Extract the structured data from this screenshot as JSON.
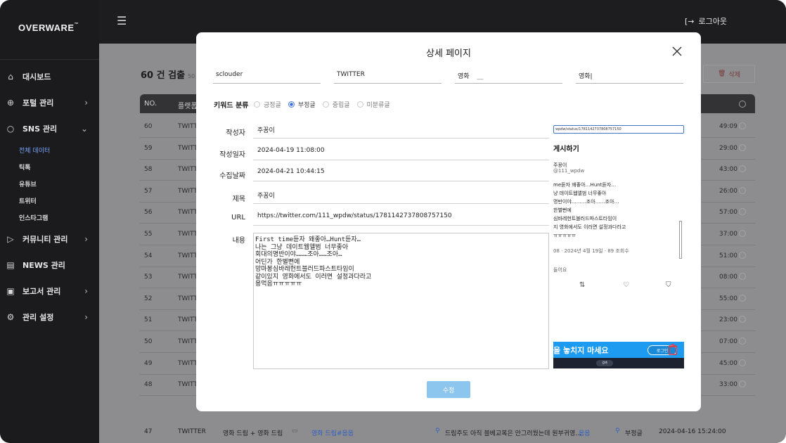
{
  "brand": {
    "logo": "OVERWARE",
    "logo_tm": "™"
  },
  "topbar": {
    "logout_label": "로그아웃"
  },
  "sidebar": {
    "items": [
      {
        "label": "대시보드"
      },
      {
        "label": "포털 관리"
      },
      {
        "label": "SNS 관리"
      },
      {
        "label": "커뮤니티 관리"
      },
      {
        "label": "NEWS 관리"
      },
      {
        "label": "보고서 관리"
      },
      {
        "label": "관리 설정"
      }
    ],
    "sns_sub": [
      "전체 데이터",
      "틱톡",
      "유튜브",
      "트위터",
      "인스타그램"
    ]
  },
  "list": {
    "count_label": "60 건 검출",
    "count_sub": "50",
    "delete_label": "삭제",
    "header": {
      "no": "NO.",
      "platform": "플랫폼"
    },
    "rows": [
      {
        "no": "60",
        "platform": "TWITT",
        "time": "49:09"
      },
      {
        "no": "59",
        "platform": "TWITT",
        "time": "29:00"
      },
      {
        "no": "58",
        "platform": "TWITT",
        "time": "43:00"
      },
      {
        "no": "57",
        "platform": "TWITT",
        "time": "26:00"
      },
      {
        "no": "56",
        "platform": "TWITT",
        "time": "57:00"
      },
      {
        "no": "55",
        "platform": "TWITT",
        "time": "37:00"
      },
      {
        "no": "54",
        "platform": "TWITT",
        "time": "51:00"
      },
      {
        "no": "53",
        "platform": "TWITT",
        "time": "08:00"
      },
      {
        "no": "52",
        "platform": "TWITT",
        "time": "55:00"
      },
      {
        "no": "51",
        "platform": "TWITT",
        "time": "23:00"
      },
      {
        "no": "50",
        "platform": "TWITT",
        "time": "07:00"
      },
      {
        "no": "49",
        "platform": "TWITT",
        "time": "45:00"
      },
      {
        "no": "48",
        "platform": "TWITT",
        "time": "33:00"
      }
    ],
    "last_row": {
      "no": "47",
      "platform": "TWITTER",
      "keyword": "영화 드림 + 영화 드림",
      "tag": "영화 드림#음음",
      "title": "드림주도 아직 블베교복은 안그러웠는데 원부귀영…",
      "tag2": "음음",
      "sentiment": "부정글",
      "datetime": "2024-04-16 15:24:00"
    }
  },
  "modal": {
    "title": "상세 페이지",
    "fields": {
      "user": "sclouder",
      "platform": "TWITTER",
      "kw1": "영화",
      "kw1_tail": "__",
      "kw2": "영화|"
    },
    "keyword_label": "키워드 분류",
    "radios": [
      "긍정글",
      "부정글",
      "중립글",
      "미분류글"
    ],
    "selected_radio": "부정글",
    "labels": {
      "author": "작성자",
      "written": "작성일자",
      "collected": "수집날짜",
      "title": "제목",
      "url": "URL",
      "content": "내용"
    },
    "values": {
      "author": "주꽁이",
      "written": "2024-04-19 11:08:00",
      "collected": "2024-04-21 10:44:15",
      "title": "주꽁이",
      "url": "https://twitter.com/111_wpdw/status/1781142737808757150"
    },
    "content": "First time듣자 왜좋아…Hunt듣자…\n나는 그냥 데이트웹앨범 너무좋아\n회대의명반이야………조아……조아…\n어딘가 한별뻔에\n망마봉심바레헌트블러드파스트타임이\n같이있지 영화에서도 이러면 설정과다라고\n용먹음ㅠㅠㅠㅠㅠ",
    "save_label": "수정",
    "preview": {
      "url": "wpdw/status/1781142737808757150",
      "heading": "게시하기",
      "name": "주꽁이",
      "handle": "@111_wpdw",
      "lines": [
        "me듣자 왜좋아…Hunt듣자…",
        "냥 데이트웹앨범 너무좋아",
        "명반이야………조아……조아…",
        "한별뻔에",
        "심바레헌트블러드파스트타임이",
        "지 영화에서도 이러면 설정과다라고",
        "ㅠㅠㅠㅠㅠ"
      ],
      "meta": "08 · 2024년 4월 19일 · 89 조회수",
      "reply": "들어요",
      "banner": "을 놓치지 마세요",
      "login": "로그인",
      "search": "검색"
    }
  }
}
